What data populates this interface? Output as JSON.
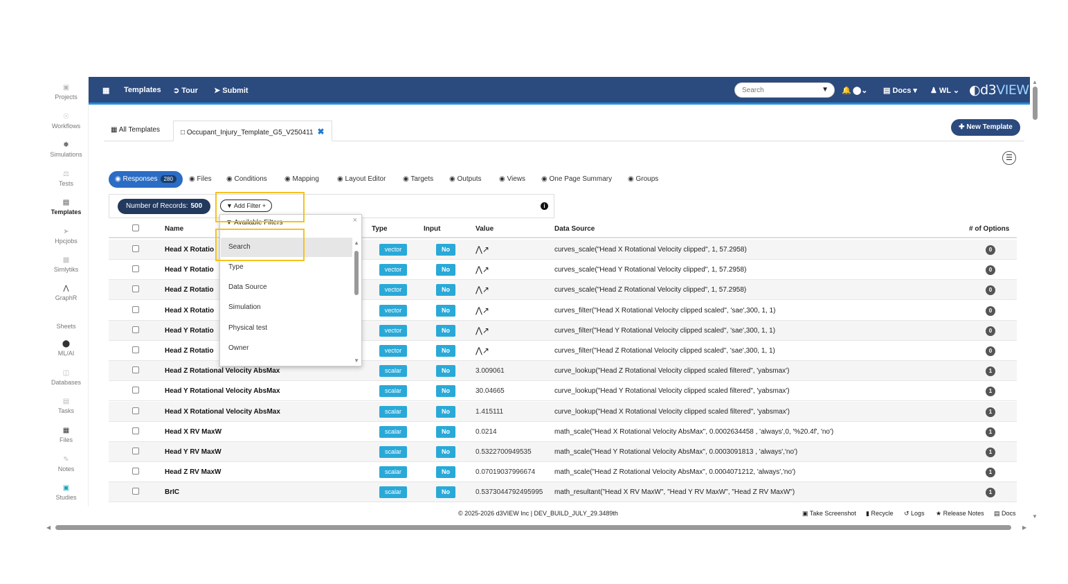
{
  "sidebar": {
    "items": [
      {
        "label": "Projects",
        "icon": "projects-icon"
      },
      {
        "label": "Workflows",
        "icon": "workflows-icon"
      },
      {
        "label": "Simulations",
        "icon": "simulations-icon"
      },
      {
        "label": "Tests",
        "icon": "tests-icon"
      },
      {
        "label": "Templates",
        "icon": "templates-icon"
      },
      {
        "label": "Hpcjobs",
        "icon": "hpcjobs-icon"
      },
      {
        "label": "Simlytiks",
        "icon": "simlytiks-icon"
      },
      {
        "label": "GraphR",
        "icon": "graphr-icon"
      },
      {
        "label": "Sheets",
        "icon": "sheets-icon"
      },
      {
        "label": "ML/AI",
        "icon": "mlai-icon"
      },
      {
        "label": "Databases",
        "icon": "databases-icon"
      },
      {
        "label": "Tasks",
        "icon": "tasks-icon"
      },
      {
        "label": "Files",
        "icon": "files-icon"
      },
      {
        "label": "Notes",
        "icon": "notes-icon"
      },
      {
        "label": "Studies",
        "icon": "studies-icon"
      }
    ]
  },
  "topbar": {
    "templates": "Templates",
    "tour": "Tour",
    "submit": "Submit",
    "search_placeholder": "Search",
    "docs": "Docs",
    "user": "WL",
    "logo_d3": "d3",
    "logo_view": "VIEW"
  },
  "tabs": {
    "all": "All Templates",
    "open": "Occupant_Injury_Template_G5_V250411",
    "new_button": "New Template"
  },
  "subtabs": {
    "responses": "Responses",
    "responses_count": "280",
    "files": "Files",
    "conditions": "Conditions",
    "mapping": "Mapping",
    "layout_editor": "Layout Editor",
    "targets": "Targets",
    "outputs": "Outputs",
    "views": "Views",
    "one_page_summary": "One Page Summary",
    "groups": "Groups"
  },
  "records": {
    "label": "Number of Records:",
    "count": "500",
    "add_filter": "Add Filter +"
  },
  "filter_dropdown": {
    "title": "Available Filters",
    "items": [
      "Search",
      "Type",
      "Data Source",
      "Simulation",
      "Physical test",
      "Owner"
    ]
  },
  "table": {
    "headers": {
      "name": "Name",
      "type": "Type",
      "input": "Input",
      "value": "Value",
      "data_source": "Data Source",
      "options": "# of Options"
    },
    "rows": [
      {
        "name": "Head X Rotatio",
        "type": "vector",
        "input": "No",
        "value": "",
        "source": "curves_scale(\"Head X Rotational Velocity clipped\", 1, 57.2958)",
        "options": "0"
      },
      {
        "name": "Head Y Rotatio",
        "type": "vector",
        "input": "No",
        "value": "",
        "source": "curves_scale(\"Head Y Rotational Velocity clipped\", 1, 57.2958)",
        "options": "0"
      },
      {
        "name": "Head Z Rotatio",
        "type": "vector",
        "input": "No",
        "value": "",
        "source": "curves_scale(\"Head Z Rotational Velocity clipped\", 1, 57.2958)",
        "options": "0"
      },
      {
        "name": "Head X Rotatio",
        "type": "vector",
        "input": "No",
        "value": "",
        "source": "curves_filter(\"Head X Rotational Velocity clipped scaled\", 'sae',300, 1, 1)",
        "options": "0"
      },
      {
        "name": "Head Y Rotatio",
        "type": "vector",
        "input": "No",
        "value": "",
        "source": "curves_filter(\"Head Y Rotational Velocity clipped scaled\", 'sae',300, 1, 1)",
        "options": "0"
      },
      {
        "name": "Head Z Rotatio",
        "type": "vector",
        "input": "No",
        "value": "",
        "source": "curves_filter(\"Head Z Rotational Velocity clipped scaled\", 'sae',300, 1, 1)",
        "options": "0"
      },
      {
        "name": "Head Z Rotational Velocity AbsMax",
        "type": "scalar",
        "input": "No",
        "value": "3.009061",
        "source": "curve_lookup(\"Head Z Rotational Velocity clipped scaled filtered\", 'yabsmax')",
        "options": "1"
      },
      {
        "name": "Head Y Rotational Velocity AbsMax",
        "type": "scalar",
        "input": "No",
        "value": "30.04665",
        "source": "curve_lookup(\"Head Y Rotational Velocity clipped scaled filtered\", 'yabsmax')",
        "options": "1"
      },
      {
        "name": "Head X Rotational Velocity AbsMax",
        "type": "scalar",
        "input": "No",
        "value": "1.415111",
        "source": "curve_lookup(\"Head X Rotational Velocity clipped scaled filtered\", 'yabsmax')",
        "options": "1"
      },
      {
        "name": "Head X RV MaxW",
        "type": "scalar",
        "input": "No",
        "value": "0.0214",
        "source": "math_scale(\"Head X Rotational Velocity AbsMax\", 0.0002634458 , 'always',0, '%20.4f', 'no')",
        "options": "1"
      },
      {
        "name": "Head Y RV MaxW",
        "type": "scalar",
        "input": "No",
        "value": "0.5322700949535",
        "source": "math_scale(\"Head Y Rotational Velocity AbsMax\", 0.0003091813 , 'always','no')",
        "options": "1"
      },
      {
        "name": "Head Z RV MaxW",
        "type": "scalar",
        "input": "No",
        "value": "0.07019037996674",
        "source": "math_scale(\"Head Z Rotational Velocity AbsMax\", 0.0004071212, 'always','no')",
        "options": "1"
      },
      {
        "name": "BrIC",
        "type": "scalar",
        "input": "No",
        "value": "0.5373044792495995",
        "source": "math_resultant(\"Head X RV MaxW\", \"Head Y RV MaxW\", \"Head Z RV MaxW\")",
        "options": "1"
      }
    ]
  },
  "footer": {
    "copyright": "© 2025-2026 d3VIEW Inc | DEV_BUILD_JULY_29.3489th",
    "screenshot": "Take Screenshot",
    "recycle": "Recycle",
    "logs": "Logs",
    "release_notes": "Release Notes",
    "docs": "Docs"
  },
  "colors": {
    "navbar": "#2b4a7e",
    "accent": "#2b6cc4",
    "pill": "#29a9d8",
    "highlight": "#f5c21b"
  }
}
